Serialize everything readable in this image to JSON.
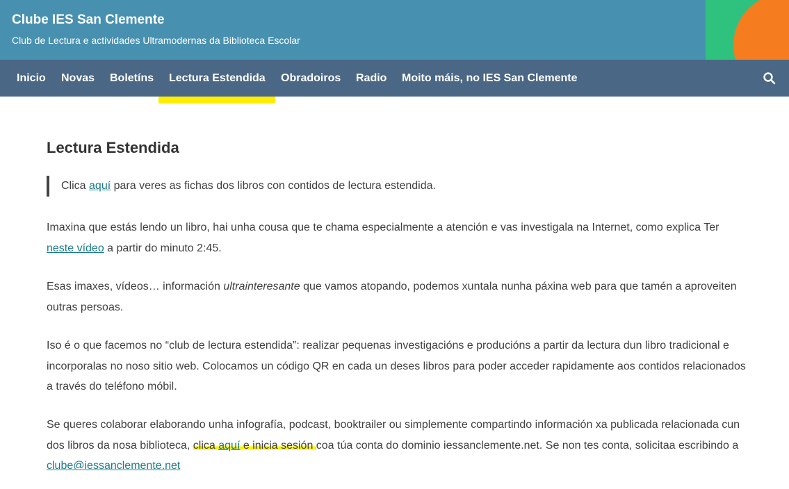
{
  "header": {
    "site_title": "Clube IES San Clemente",
    "site_description": "Club de Lectura e actividades Ultramodernas da Biblioteca Escolar"
  },
  "nav": {
    "items": [
      "Inicio",
      "Novas",
      "Boletíns",
      "Lectura Estendida",
      "Obradoiros",
      "Radio",
      "Moito máis, no IES San Clemente"
    ],
    "active_index": 3,
    "search_icon": "search-icon"
  },
  "colors": {
    "header_bg": "#4890b0",
    "nav_bg": "#4a6785",
    "highlight": "#ffee00",
    "link": "#1a7a8a",
    "deco_green": "#2ec27e",
    "deco_orange": "#f57c1f"
  },
  "main": {
    "title": "Lectura Estendida",
    "quote": {
      "before": "Clica ",
      "link": "aquí",
      "after": " para veres as fichas dos libros con contidos de lectura estendida."
    },
    "p1": {
      "before": "Imaxina que estás lendo un libro, hai unha cousa que te chama especialmente a atención e vas investigala na Internet, como explica Ter ",
      "link": "neste vídeo",
      "after": " a partir do minuto 2:45."
    },
    "p2": {
      "before": "Esas imaxes, vídeos… información ",
      "em": "ultrainteresante",
      "after": " que vamos atopando, podemos xuntala nunha páxina web para que tamén a aproveiten outras persoas."
    },
    "p3": {
      "text": "Iso é o que facemos no “club de lectura estendida”: realizar pequenas investigacións e producións a partir da lectura dun libro tradicional e incorporalas no noso sitio web. Colocamos un código QR en cada un deses libros para poder acceder rapidamente aos contidos relacionados a través do teléfono móbil."
    },
    "p4": {
      "before": "Se queres colaborar elaborando unha infografía, podcast, booktrailer ou simplemente compartindo información xa publicada relacionada cun dos libros da nosa biblioteca, ",
      "hl1": "clica ",
      "link": "aquí",
      "hl2": " e inicia sesión ",
      "mid": "coa túa conta do dominio iessanclemente.net. Se non tes conta, solicitaa escribindo a ",
      "email": "clube@iessanclemente.net"
    }
  }
}
